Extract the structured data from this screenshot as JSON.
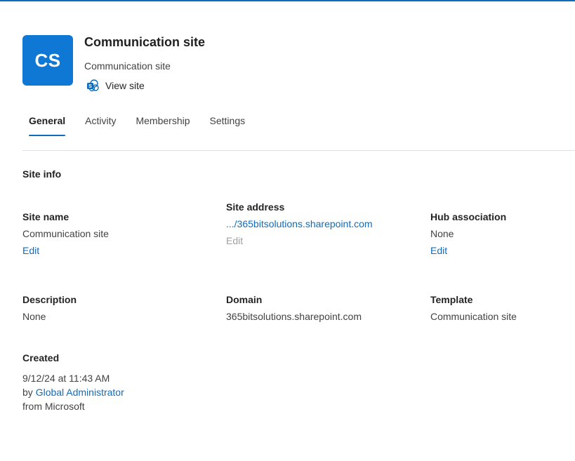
{
  "header": {
    "avatar_initials": "CS",
    "title": "Communication site",
    "subtitle": "Communication site",
    "view_site_label": "View site",
    "view_site_icon": "sharepoint-icon"
  },
  "tabs": [
    {
      "label": "General",
      "active": true
    },
    {
      "label": "Activity",
      "active": false
    },
    {
      "label": "Membership",
      "active": false
    },
    {
      "label": "Settings",
      "active": false
    }
  ],
  "site_info": {
    "section_title": "Site info",
    "site_name": {
      "label": "Site name",
      "value": "Communication site",
      "action": "Edit"
    },
    "site_address": {
      "label": "Site address",
      "value": ".../365bitsolutions.sharepoint.com",
      "action": "Edit"
    },
    "hub_association": {
      "label": "Hub association",
      "value": "None",
      "action": "Edit"
    },
    "description": {
      "label": "Description",
      "value": "None"
    },
    "domain": {
      "label": "Domain",
      "value": "365bitsolutions.sharepoint.com"
    },
    "template": {
      "label": "Template",
      "value": "Communication site"
    },
    "created": {
      "label": "Created",
      "date": "9/12/24 at 11:43 AM",
      "by_prefix": "by",
      "by_user": "Global Administrator",
      "from": "from Microsoft"
    }
  },
  "colors": {
    "accent": "#0f6cbd",
    "avatar_bg": "#0f78d4",
    "disabled_text": "#a0a0a0"
  }
}
